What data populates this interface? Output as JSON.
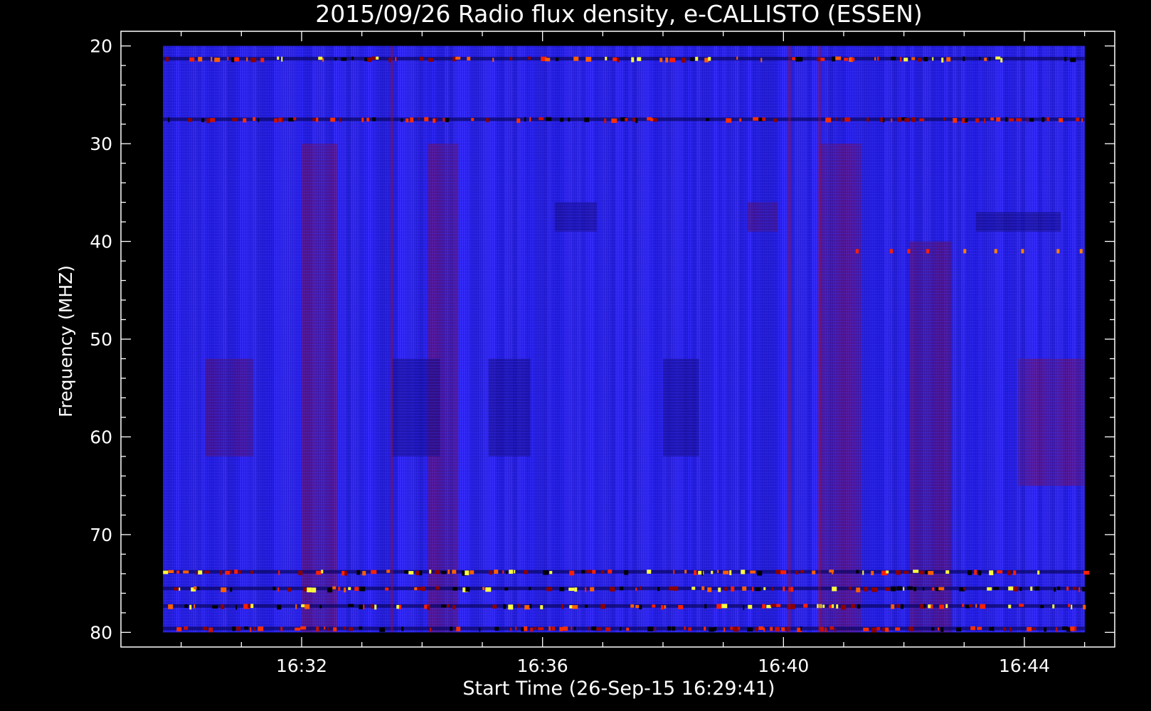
{
  "chart_data": {
    "type": "heatmap",
    "title": "2015/09/26  Radio flux density, e-CALLISTO (ESSEN)",
    "xlabel": "Start Time (26-Sep-15 16:29:41)",
    "ylabel": "Frequency (MHZ)",
    "x_ticks": [
      {
        "label": "16:32",
        "minutes": 32
      },
      {
        "label": "16:36",
        "minutes": 36
      },
      {
        "label": "16:40",
        "minutes": 40
      },
      {
        "label": "16:44",
        "minutes": 44
      }
    ],
    "y_ticks": [
      {
        "label": "20",
        "value": 20
      },
      {
        "label": "30",
        "value": 30
      },
      {
        "label": "40",
        "value": 40
      },
      {
        "label": "50",
        "value": 50
      },
      {
        "label": "60",
        "value": 60
      },
      {
        "label": "70",
        "value": 70
      },
      {
        "label": "80",
        "value": 80
      }
    ],
    "xlim_minutes": [
      29.0,
      45.5
    ],
    "data_xlim_minutes": [
      29.7,
      45.0
    ],
    "ylim": [
      81.5,
      18.5
    ],
    "data_ylim": [
      80,
      20
    ],
    "x_minor_step_minutes": 1,
    "y_minor_step": 2,
    "colormap": [
      "#000000",
      "#0000ff",
      "#8b0000",
      "#ff0000",
      "#ffff00"
    ],
    "background_color": "#2a22ea",
    "features": [
      {
        "kind": "band",
        "freq": 21.3,
        "x0": 29.7,
        "x1": 45.0,
        "intensity": "high"
      },
      {
        "kind": "band",
        "freq": 27.5,
        "x0": 29.7,
        "x1": 45.0,
        "intensity": "medium"
      },
      {
        "kind": "band",
        "freq": 73.8,
        "x0": 29.7,
        "x1": 45.0,
        "intensity": "high"
      },
      {
        "kind": "band",
        "freq": 75.5,
        "x0": 29.7,
        "x1": 45.0,
        "intensity": "high"
      },
      {
        "kind": "band",
        "freq": 77.3,
        "x0": 29.7,
        "x1": 45.0,
        "intensity": "high"
      },
      {
        "kind": "band",
        "freq": 79.6,
        "x0": 29.7,
        "x1": 45.0,
        "intensity": "medium"
      },
      {
        "kind": "dotted_band",
        "freq": 41.0,
        "x0": 41.2,
        "x1": 45.0
      },
      {
        "kind": "vertical",
        "time": 40.1,
        "f0": 20,
        "f1": 80
      },
      {
        "kind": "vertical",
        "time": 40.6,
        "f0": 20,
        "f1": 80
      },
      {
        "kind": "vertical",
        "time": 33.5,
        "f0": 20,
        "f1": 80
      }
    ]
  }
}
